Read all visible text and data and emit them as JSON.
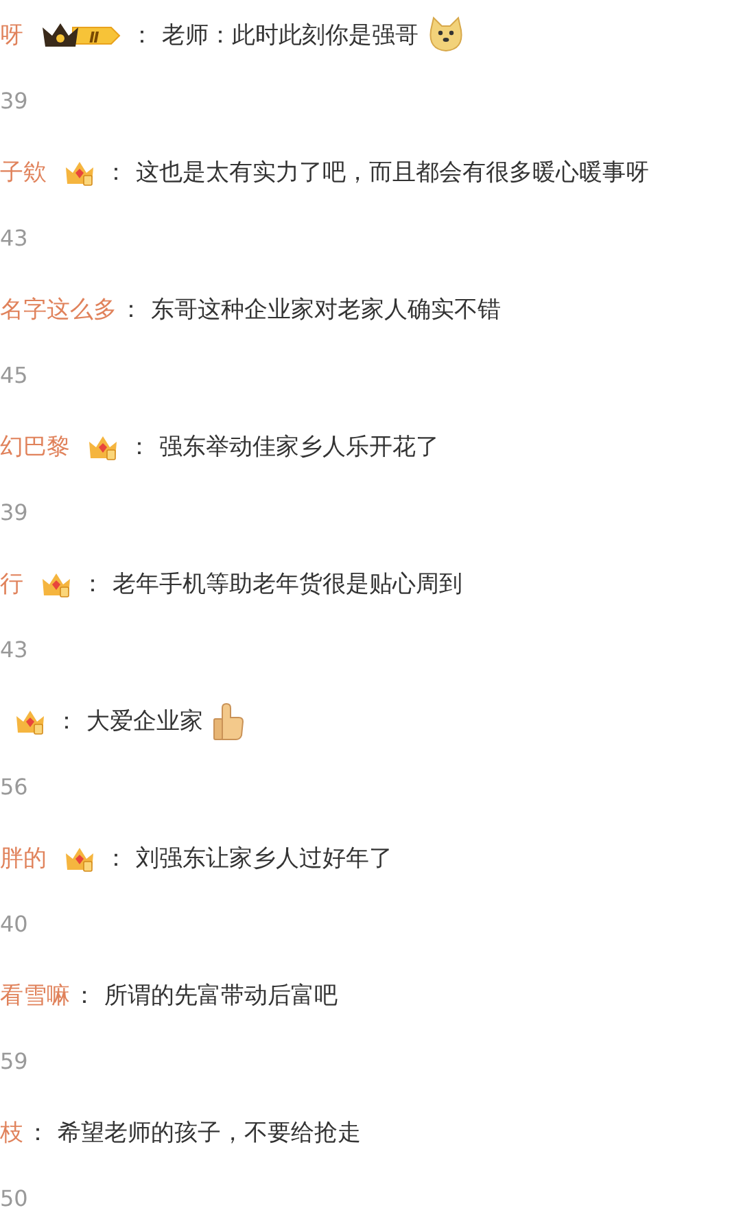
{
  "comments": [
    {
      "name": "呀",
      "badge": {
        "kind": "vip",
        "label": "Ⅱ"
      },
      "separator": "：",
      "text": "老师：此时此刻你是强哥",
      "emoji": {
        "kind": "doge"
      },
      "count": "39"
    },
    {
      "name": "子欸",
      "badge": {
        "kind": "crown"
      },
      "separator": "：",
      "text": "这也是太有实力了吧，而且都会有很多暖心暖事呀",
      "count": "43"
    },
    {
      "name": "名字这么多",
      "separator": "：",
      "text": "东哥这种企业家对老家人确实不错",
      "count": "45"
    },
    {
      "name": "幻巴黎",
      "badge": {
        "kind": "crown"
      },
      "separator": "：",
      "text": "强东举动佳家乡人乐开花了",
      "count": "39"
    },
    {
      "name": "行",
      "badge": {
        "kind": "crown"
      },
      "separator": "：",
      "text": "老年手机等助老年货很是贴心周到",
      "count": "43"
    },
    {
      "badge": {
        "kind": "crown"
      },
      "separator": "：",
      "text": "大爱企业家",
      "emoji": {
        "kind": "thumbs"
      },
      "count": "56"
    },
    {
      "name": "胖的",
      "badge": {
        "kind": "crown"
      },
      "separator": "：",
      "text": "刘强东让家乡人过好年了",
      "count": "40"
    },
    {
      "name": "看雪嘛",
      "separator": "：",
      "text": "所谓的先富带动后富吧",
      "count": "59"
    },
    {
      "name": "枝",
      "separator": "：",
      "text": "希望老师的孩子，不要给抢走",
      "count": "50"
    }
  ]
}
